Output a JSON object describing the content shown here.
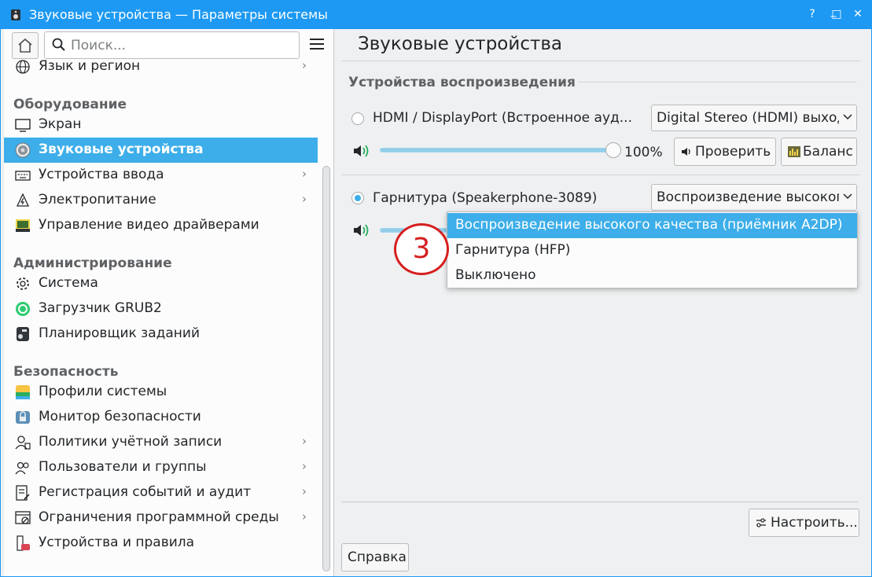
{
  "window": {
    "title": "Звуковые устройства  — Параметры системы",
    "buttons": {
      "help": "?",
      "minimize": "_",
      "maximize": "□",
      "close": "✕"
    }
  },
  "sidebar": {
    "search_placeholder": "Поиск...",
    "items": [
      {
        "type": "item",
        "label": "Язык и регион",
        "icon": "globe-icon",
        "chevron": true
      },
      {
        "type": "category",
        "label": "Оборудование"
      },
      {
        "type": "item",
        "label": "Экран",
        "icon": "monitor-icon",
        "chevron": false
      },
      {
        "type": "item",
        "label": "Звуковые устройства",
        "icon": "speaker-icon",
        "chevron": false,
        "active": true
      },
      {
        "type": "item",
        "label": "Устройства ввода",
        "icon": "keyboard-icon",
        "chevron": true
      },
      {
        "type": "item",
        "label": "Электропитание",
        "icon": "power-icon",
        "chevron": true
      },
      {
        "type": "item",
        "label": "Управление видео драйверами",
        "icon": "video-driver-icon",
        "chevron": false
      },
      {
        "type": "category",
        "label": "Администрирование"
      },
      {
        "type": "item",
        "label": "Система",
        "icon": "gear-icon",
        "chevron": false
      },
      {
        "type": "item",
        "label": "Загрузчик GRUB2",
        "icon": "grub-icon",
        "chevron": false
      },
      {
        "type": "item",
        "label": "Планировщик заданий",
        "icon": "scheduler-icon",
        "chevron": false
      },
      {
        "type": "category",
        "label": "Безопасность"
      },
      {
        "type": "item",
        "label": "Профили системы",
        "icon": "profiles-icon",
        "chevron": false
      },
      {
        "type": "item",
        "label": "Монитор безопасности",
        "icon": "lock-monitor-icon",
        "chevron": false
      },
      {
        "type": "item",
        "label": "Политики учётной записи",
        "icon": "user-policy-icon",
        "chevron": true
      },
      {
        "type": "item",
        "label": "Пользователи и группы",
        "icon": "users-icon",
        "chevron": true
      },
      {
        "type": "item",
        "label": "Регистрация событий и аудит",
        "icon": "audit-icon",
        "chevron": true
      },
      {
        "type": "item",
        "label": "Ограничения программной среды",
        "icon": "restriction-icon",
        "chevron": true
      },
      {
        "type": "item",
        "label": "Устройства и правила",
        "icon": "device-rules-icon",
        "chevron": false
      }
    ]
  },
  "main": {
    "title": "Звуковые устройства",
    "section": "Устройства воспроизведения",
    "devices": [
      {
        "name": "HDMI / DisplayPort (Встроенное ауд...",
        "selected": false,
        "profile": "Digital Stereo (HDMI) выход",
        "volume_label": "100%",
        "volume": 100,
        "test_label": "Проверить",
        "balance_label": "Баланс"
      },
      {
        "name": "Гарнитура (Speakerphone-3089)",
        "selected": true,
        "profile": "Воспроизведение высокого"
      }
    ],
    "dropdown_options": [
      "Воспроизведение высокого качества (приёмник A2DP)",
      "Гарнитура (HFP)",
      "Выключено"
    ],
    "dropdown_selected_index": 0,
    "step_marker": "3",
    "configure_label": "Настроить...",
    "help_label": "Справка"
  }
}
